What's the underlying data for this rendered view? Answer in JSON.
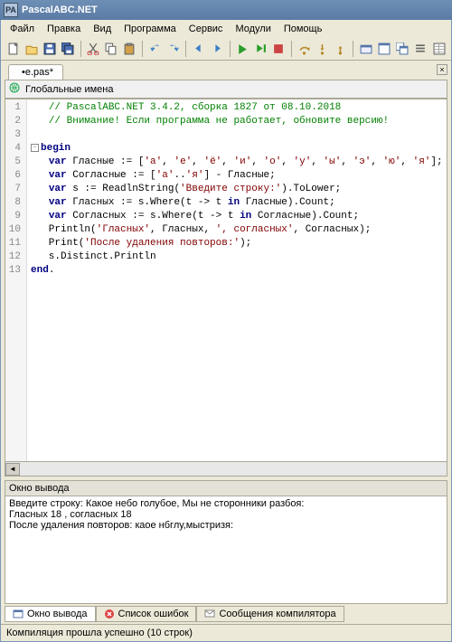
{
  "app": {
    "title": "PascalABC.NET",
    "icon_label": "PA"
  },
  "menu": {
    "items": [
      "Файл",
      "Правка",
      "Вид",
      "Программа",
      "Сервис",
      "Модули",
      "Помощь"
    ]
  },
  "toolbar_icons": [
    "new-file-icon",
    "open-file-icon",
    "save-icon",
    "save-all-icon",
    "sep",
    "cut-icon",
    "copy-icon",
    "paste-icon",
    "sep",
    "undo-icon",
    "redo-icon",
    "sep",
    "back-icon",
    "forward-icon",
    "sep",
    "run-icon",
    "run-step-icon",
    "stop-icon",
    "sep",
    "step-over-icon",
    "step-into-icon",
    "step-out-icon",
    "sep",
    "module-icon",
    "window-icon",
    "windows-icon",
    "list-icon",
    "props-icon"
  ],
  "tabs": {
    "active": "•e.pas*",
    "close": "×"
  },
  "header": {
    "icon": "globe-icon",
    "text": "Глобальные имена"
  },
  "code": {
    "lines": [
      {
        "n": "1",
        "seg": [
          {
            "t": "   ",
            "c": ""
          },
          {
            "t": "// PascalABC.NET 3.4.2, сборка 1827 от 08.10.2018",
            "c": "c-comment"
          }
        ]
      },
      {
        "n": "2",
        "seg": [
          {
            "t": "   ",
            "c": ""
          },
          {
            "t": "// Внимание! Если программа не работает, обновите версию!",
            "c": "c-comment"
          }
        ]
      },
      {
        "n": "3",
        "seg": [
          {
            "t": " ",
            "c": ""
          }
        ]
      },
      {
        "n": "4",
        "fold": "-",
        "seg": [
          {
            "t": "begin",
            "c": "c-kw"
          }
        ]
      },
      {
        "n": "5",
        "seg": [
          {
            "t": "   ",
            "c": ""
          },
          {
            "t": "var",
            "c": "c-kw"
          },
          {
            "t": " Гласные := [",
            "c": ""
          },
          {
            "t": "'а'",
            "c": "c-str"
          },
          {
            "t": ", ",
            "c": ""
          },
          {
            "t": "'е'",
            "c": "c-str"
          },
          {
            "t": ", ",
            "c": ""
          },
          {
            "t": "'ё'",
            "c": "c-str"
          },
          {
            "t": ", ",
            "c": ""
          },
          {
            "t": "'и'",
            "c": "c-str"
          },
          {
            "t": ", ",
            "c": ""
          },
          {
            "t": "'о'",
            "c": "c-str"
          },
          {
            "t": ", ",
            "c": ""
          },
          {
            "t": "'у'",
            "c": "c-str"
          },
          {
            "t": ", ",
            "c": ""
          },
          {
            "t": "'ы'",
            "c": "c-str"
          },
          {
            "t": ", ",
            "c": ""
          },
          {
            "t": "'э'",
            "c": "c-str"
          },
          {
            "t": ", ",
            "c": ""
          },
          {
            "t": "'ю'",
            "c": "c-str"
          },
          {
            "t": ", ",
            "c": ""
          },
          {
            "t": "'я'",
            "c": "c-str"
          },
          {
            "t": "];",
            "c": ""
          }
        ]
      },
      {
        "n": "6",
        "seg": [
          {
            "t": "   ",
            "c": ""
          },
          {
            "t": "var",
            "c": "c-kw"
          },
          {
            "t": " Согласные := [",
            "c": ""
          },
          {
            "t": "'а'",
            "c": "c-str"
          },
          {
            "t": "..",
            "c": ""
          },
          {
            "t": "'я'",
            "c": "c-str"
          },
          {
            "t": "] - Гласные;",
            "c": ""
          }
        ]
      },
      {
        "n": "7",
        "seg": [
          {
            "t": "   ",
            "c": ""
          },
          {
            "t": "var",
            "c": "c-kw"
          },
          {
            "t": " s := ReadlnString(",
            "c": ""
          },
          {
            "t": "'Введите строку:'",
            "c": "c-str"
          },
          {
            "t": ").ToLower;",
            "c": ""
          }
        ]
      },
      {
        "n": "8",
        "seg": [
          {
            "t": "   ",
            "c": ""
          },
          {
            "t": "var",
            "c": "c-kw"
          },
          {
            "t": " Гласных := s.Where(t -> t ",
            "c": ""
          },
          {
            "t": "in",
            "c": "c-kw"
          },
          {
            "t": " Гласные).Count;",
            "c": ""
          }
        ]
      },
      {
        "n": "9",
        "seg": [
          {
            "t": "   ",
            "c": ""
          },
          {
            "t": "var",
            "c": "c-kw"
          },
          {
            "t": " Согласных := s.Where(t -> t ",
            "c": ""
          },
          {
            "t": "in",
            "c": "c-kw"
          },
          {
            "t": " Согласные).Count;",
            "c": ""
          }
        ]
      },
      {
        "n": "10",
        "seg": [
          {
            "t": "   Println(",
            "c": ""
          },
          {
            "t": "'Гласных'",
            "c": "c-str"
          },
          {
            "t": ", Гласных, ",
            "c": ""
          },
          {
            "t": "', согласных'",
            "c": "c-str"
          },
          {
            "t": ", Согласных);",
            "c": ""
          }
        ]
      },
      {
        "n": "11",
        "seg": [
          {
            "t": "   Print(",
            "c": ""
          },
          {
            "t": "'После удаления повторов:'",
            "c": "c-str"
          },
          {
            "t": ");",
            "c": ""
          }
        ]
      },
      {
        "n": "12",
        "seg": [
          {
            "t": "   s.Distinct.Println",
            "c": ""
          }
        ]
      },
      {
        "n": "13",
        "seg": [
          {
            "t": "end",
            "c": "c-kw"
          },
          {
            "t": ".",
            "c": ""
          }
        ]
      }
    ]
  },
  "output": {
    "title": "Окно вывода",
    "text": "Введите строку: Какое небо голубое, Мы не сторонники разбоя:\nГласных 18 , согласных 18\nПосле удаления повторов: кaое нбглу,мыстризя:"
  },
  "bottom_tabs": {
    "items": [
      {
        "label": "Окно вывода",
        "icon": "output-icon",
        "active": true
      },
      {
        "label": "Список ошибок",
        "icon": "error-icon",
        "active": false
      },
      {
        "label": "Сообщения компилятора",
        "icon": "message-icon",
        "active": false
      }
    ]
  },
  "status": {
    "text": "Компиляция прошла успешно (10 строк)"
  }
}
